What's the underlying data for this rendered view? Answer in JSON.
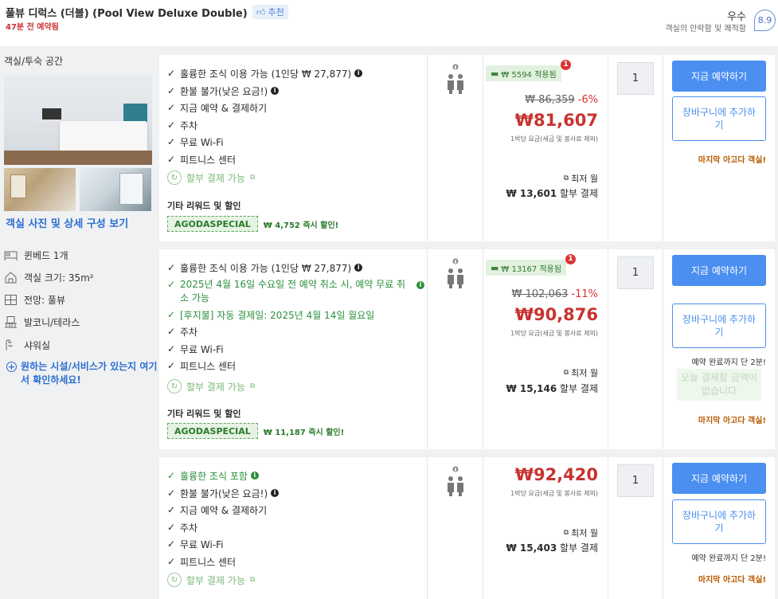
{
  "header": {
    "room_title": "풀뷰 디럭스 (더블) (Pool View Deluxe Double)",
    "recommend": "추천",
    "booked_note": "47분 전 예약됨",
    "rating_word": "우수",
    "rating_sub": "객실의 안락함 및 쾌적함",
    "rating_score": "8.9"
  },
  "left": {
    "section_title": "객실/투숙 공간",
    "photos_link": "객실 사진 및 상세 구성 보기",
    "features": [
      {
        "icon": "bed-icon",
        "label": "퀸베드 1개"
      },
      {
        "icon": "room-size-icon",
        "label": "객실 크기: 35m²"
      },
      {
        "icon": "view-icon",
        "label": "전망: 풀뷰"
      },
      {
        "icon": "balcony-icon",
        "label": "발코니/테라스"
      },
      {
        "icon": "shower-icon",
        "label": "샤워실"
      }
    ],
    "more_link": "원하는 시설/서비스가 있는지 여기서 확인하세요!"
  },
  "offers": [
    {
      "benefits": [
        "훌륭한 조식 이용 가능 (1인당 ₩ 27,877)",
        "환불 불가(낮은 요금!)",
        "지금 예약 & 결제하기",
        "주차",
        "무료 Wi-Fi",
        "피트니스 센터"
      ],
      "installment": "할부 결제 가능",
      "rewards_title": "기타 리워드 및 할인",
      "promo_code": "AGODASPECIAL",
      "promo_discount": "₩ 4,752 즉시 할인!",
      "cashback": "₩ 5594 적용됨",
      "cashback_badge": "1",
      "orig_price": "₩ 86,359",
      "discount_pct": "-6%",
      "price": "₩81,607",
      "per_night": "1박당 요금(세금 및 봉사료 제외)",
      "min_month": "최저 월",
      "installment_amount": "₩ 13,601",
      "installment_suffix": "할부 결제",
      "qty": "1",
      "book_label": "지금 예약하기",
      "cart_label": "장바구니에 추가하기",
      "last_room": "마지막 아고다 객실!"
    },
    {
      "benefits": [
        "훌륭한 조식 이용 가능 (1인당 ₩ 27,877)",
        "2025년 4월 16일 수요일 전 예약 취소 시, 예약 무료 취소 가능",
        "[후지불] 자동 결제일: 2025년 4월 14일 월요일",
        "주차",
        "무료 Wi-Fi",
        "피트니스 센터"
      ],
      "installment": "할부 결제 가능",
      "rewards_title": "기타 리워드 및 할인",
      "promo_code": "AGODASPECIAL",
      "promo_discount": "₩ 11,187 즉시 할인!",
      "cashback": "₩ 13167 적용됨",
      "cashback_badge": "1",
      "orig_price": "₩ 102,063",
      "discount_pct": "-11%",
      "price": "₩90,876",
      "per_night": "1박당 요금(세금 및 봉사료 제외)",
      "min_month": "최저 월",
      "installment_amount": "₩ 15,146",
      "installment_suffix": "할부 결제",
      "qty": "1",
      "book_label": "지금 예약하기",
      "cart_label": "장바구니에 추가하기",
      "until_note": "예약 완료까지 단 2분!",
      "no_fee": "오늘 결제할 금액이 없습니다",
      "last_room": "마지막 아고다 객실!"
    },
    {
      "benefits": [
        "훌륭한 조식 포함",
        "환불 불가(낮은 요금!)",
        "지금 예약 & 결제하기",
        "주차",
        "무료 Wi-Fi",
        "피트니스 센터"
      ],
      "installment": "할부 결제 가능",
      "price": "₩92,420",
      "per_night": "1박당 요금(세금 및 봉사료 제외)",
      "min_month": "최저 월",
      "installment_amount": "₩ 15,403",
      "installment_suffix": "할부 결제",
      "qty": "1",
      "book_label": "지금 예약하기",
      "cart_label": "장바구니에 추가하기",
      "until_note": "예약 완료까지 단 2분!",
      "last_room": "마지막 아고다 객실!"
    }
  ]
}
